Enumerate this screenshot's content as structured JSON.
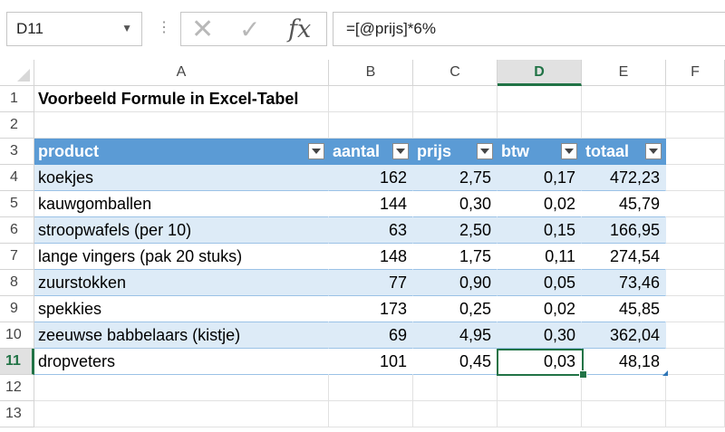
{
  "namebox": {
    "value": "D11"
  },
  "formula_bar": {
    "fx": "fx",
    "formula": "=[@prijs]*6%"
  },
  "columns": [
    "A",
    "B",
    "C",
    "D",
    "E",
    "F"
  ],
  "rows": [
    "1",
    "2",
    "3",
    "4",
    "5",
    "6",
    "7",
    "8",
    "9",
    "10",
    "11",
    "12",
    "13"
  ],
  "title": "Voorbeeld Formule in Excel-Tabel",
  "headers": [
    "product",
    "aantal",
    "prijs",
    "btw",
    "totaal"
  ],
  "data": [
    [
      "koekjes",
      "162",
      "2,75",
      "0,17",
      "472,23"
    ],
    [
      "kauwgomballen",
      "144",
      "0,30",
      "0,02",
      "45,79"
    ],
    [
      "stroopwafels (per 10)",
      "63",
      "2,50",
      "0,15",
      "166,95"
    ],
    [
      "lange vingers (pak 20 stuks)",
      "148",
      "1,75",
      "0,11",
      "274,54"
    ],
    [
      "zuurstokken",
      "77",
      "0,90",
      "0,05",
      "73,46"
    ],
    [
      "spekkies",
      "173",
      "0,25",
      "0,02",
      "45,85"
    ],
    [
      "zeeuwse babbelaars (kistje)",
      "69",
      "4,95",
      "0,30",
      "362,04"
    ],
    [
      "dropveters",
      "101",
      "0,45",
      "0,03",
      "48,18"
    ]
  ],
  "colors": {
    "header_blue": "#5b9bd5",
    "band_blue": "#ddebf7",
    "excel_green": "#217346"
  }
}
